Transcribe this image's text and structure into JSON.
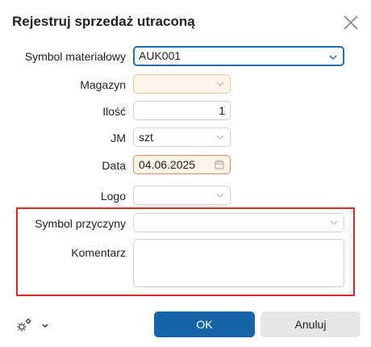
{
  "dialog": {
    "title": "Rejestruj sprzedaż utraconą"
  },
  "form": {
    "symbol_label": "Symbol materiałowy",
    "symbol_value": "AUK001",
    "magazyn_label": "Magazyn",
    "magazyn_value": "",
    "ilosc_label": "Ilość",
    "ilosc_value": "1",
    "jm_label": "JM",
    "jm_value": "szt",
    "data_label": "Data",
    "data_value": "04.06.2025",
    "logo_label": "Logo",
    "logo_value": "",
    "przyczyna_label": "Symbol przyczyny",
    "przyczyna_value": "",
    "komentarz_label": "Komentarz",
    "komentarz_value": ""
  },
  "buttons": {
    "ok_label": "OK",
    "cancel_label": "Anuluj"
  },
  "icons": {
    "close": "close-icon",
    "settings": "gear-icon",
    "dropdown": "chevron-down-icon",
    "calendar": "calendar-icon"
  },
  "colors": {
    "primary_button": "#1565a8",
    "focus_border": "#1f6fb0",
    "highlight_box": "#d9262b",
    "required_field_bg": "#fdf4e7"
  }
}
